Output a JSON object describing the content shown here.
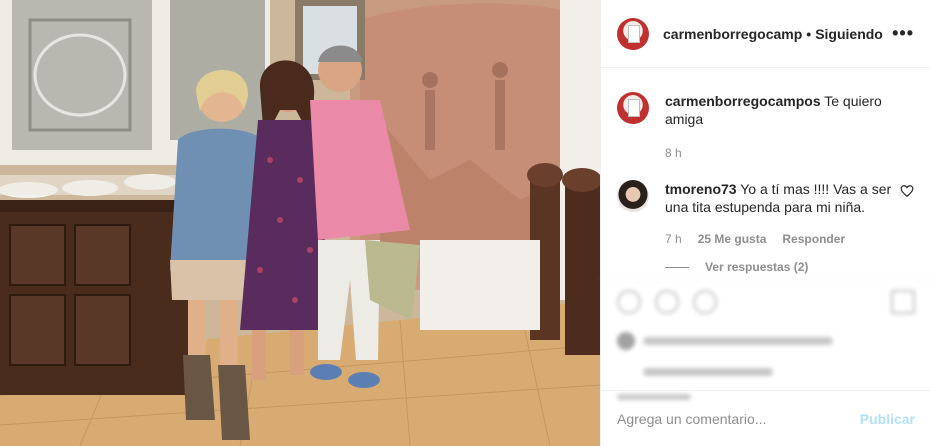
{
  "post": {
    "author": "carmenborregocamp",
    "separator": "•",
    "follow_state": "Siguiendo",
    "more_icon": "more-options-icon"
  },
  "caption": {
    "username": "carmenborregocampos",
    "text": "Te quiero amiga",
    "age": "8 h"
  },
  "comment": {
    "username": "tmoreno73",
    "text": "Yo a tí mas !!!! Vas a ser una tita estupenda para mi niña.",
    "age": "7 h",
    "likes": "25 Me gusta",
    "reply_label": "Responder",
    "view_replies": "Ver respuestas (2)"
  },
  "add_comment": {
    "placeholder": "Agrega un comentario...",
    "publish_label": "Publicar"
  },
  "colors": {
    "link_disabled": "#b2dffc",
    "muted": "#8e8e8e",
    "text": "#262626"
  }
}
